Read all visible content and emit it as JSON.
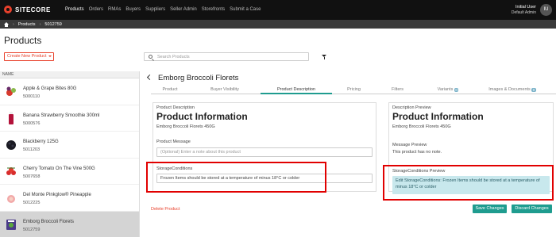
{
  "brand": {
    "name": "SITECORE"
  },
  "nav": {
    "links": [
      "Products",
      "Orders",
      "RMAs",
      "Buyers",
      "Suppliers",
      "Seller Admin",
      "Storefronts",
      "Submit a Case"
    ],
    "active": "Products"
  },
  "user": {
    "name": "Initial User",
    "role": "Default Admin",
    "initials": "IU"
  },
  "breadcrumb": {
    "items": [
      "Products",
      "5012759"
    ]
  },
  "page": {
    "title": "Products",
    "create_label": "Create New Product"
  },
  "search": {
    "placeholder": "Search Products"
  },
  "list": {
    "header": "NAME",
    "items": [
      {
        "name": "Apple & Grape Bites 80G",
        "id": "5000110",
        "active": false
      },
      {
        "name": "Banana Strawberry Smoothie 300ml",
        "id": "5000576",
        "active": false
      },
      {
        "name": "Blackberry 125G",
        "id": "5011203",
        "active": false
      },
      {
        "name": "Cherry Tomato On The Vine 500G",
        "id": "5007658",
        "active": false
      },
      {
        "name": "Del Monte Pinkglow® Pineapple",
        "id": "5012225",
        "active": false
      },
      {
        "name": "Emborg Broccoli Florets",
        "id": "5012759",
        "active": true
      }
    ]
  },
  "detail": {
    "title": "Emborg Broccoli Florets",
    "tabs": [
      {
        "label": "Product",
        "active": false
      },
      {
        "label": "Buyer Visibility",
        "active": false
      },
      {
        "label": "Product Description",
        "active": true
      },
      {
        "label": "Pricing",
        "active": false
      },
      {
        "label": "Filters",
        "active": false
      },
      {
        "label": "Variants",
        "badge": "0",
        "active": false
      },
      {
        "label": "Images & Documents",
        "badge": "0",
        "active": false
      }
    ]
  },
  "form": {
    "section_label": "Product Description",
    "heading": "Product Information",
    "subheading": "Emborg Broccoli Florets 450G",
    "message_label": "Product Message",
    "message_placeholder": "(Optional) Enter a note about this product",
    "storage_label": "StorageConditions",
    "storage_value": "Frozen Items should be stored at a temperature of minus 18°C or colder"
  },
  "preview": {
    "section_label": "Description Preview",
    "heading": "Product Information",
    "subheading": "Emborg Broccoli Florets 450G",
    "message_label": "Message Preview",
    "message_text": "This product has no note.",
    "storage_label": "StorageConditions Preview",
    "storage_text": "Edit StorageConditions: Frozen Items should be stored at a temperature of minus 18°C or colder"
  },
  "actions": {
    "delete": "Delete Product",
    "save": "Save Changes",
    "discard": "Discard Changes"
  },
  "colors": {
    "brand": "#e8412c",
    "accent": "#1f9c8f",
    "highlight": "#e10000",
    "alert_bg": "#c8e8ed"
  }
}
